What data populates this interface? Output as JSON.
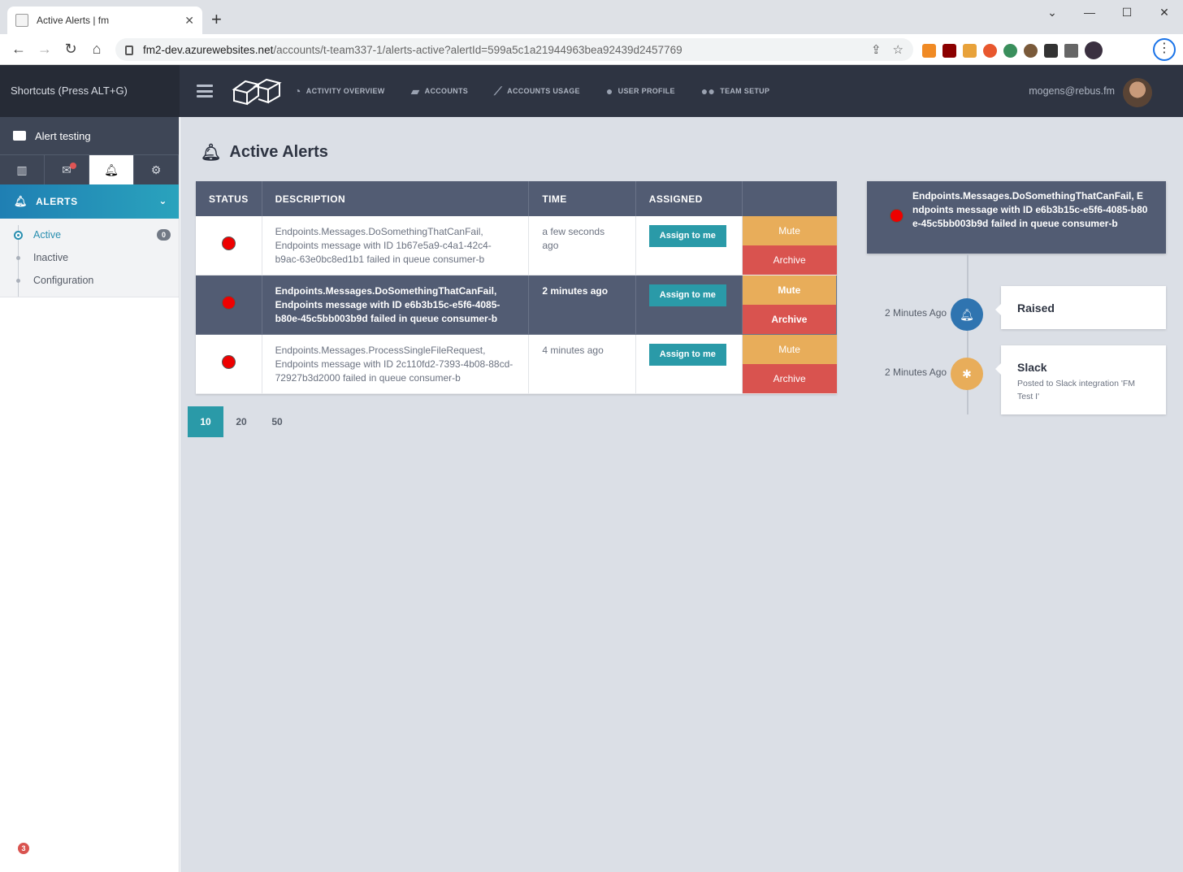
{
  "browser": {
    "tab_title": "Active Alerts | fm",
    "new_tab": "+",
    "url_host": "fm2-dev.azurewebsites.net",
    "url_path": "/accounts/t-team337-1/alerts-active?alertId=599a5c1a21944963bea92439d2457769",
    "window_buttons": [
      "⌄",
      "—",
      "☐",
      "✕"
    ]
  },
  "header": {
    "shortcuts": "Shortcuts (Press ALT+G)",
    "nav": [
      {
        "label": "ACTIVITY OVERVIEW",
        "icon": "dashboard-icon"
      },
      {
        "label": "ACCOUNTS",
        "icon": "folder-icon"
      },
      {
        "label": "ACCOUNTS USAGE",
        "icon": "line-chart-icon"
      },
      {
        "label": "USER PROFILE",
        "icon": "user-icon"
      },
      {
        "label": "TEAM SETUP",
        "icon": "users-icon"
      }
    ],
    "user": "mogens@rebus.fm"
  },
  "sidebar": {
    "project": "Alert testing",
    "section": "ALERTS",
    "items": [
      {
        "label": "Active",
        "count": "0"
      },
      {
        "label": "Inactive"
      },
      {
        "label": "Configuration"
      }
    ],
    "notification_count": "3"
  },
  "main": {
    "title": "Active Alerts",
    "columns": [
      "STATUS",
      "DESCRIPTION",
      "TIME",
      "ASSIGNED",
      ""
    ],
    "rows": [
      {
        "description": "Endpoints.Messages.DoSomethingThatCanFail, Endpoints message with ID 1b67e5a9-c4a1-42c4-b9ac-63e0bc8ed1b1 failed in queue consumer-b",
        "time": "a few seconds ago",
        "assign": "Assign to me",
        "mute": "Mute",
        "archive": "Archive"
      },
      {
        "description": "Endpoints.Messages.DoSomethingThatCanFail, Endpoints message with ID e6b3b15c-e5f6-4085-b80e-45c5bb003b9d failed in queue consumer-b",
        "time": "2 minutes ago",
        "assign": "Assign to me",
        "mute": "Mute",
        "archive": "Archive"
      },
      {
        "description": "Endpoints.Messages.ProcessSingleFileRequest, Endpoints message with ID 2c110fd2-7393-4b08-88cd-72927b3d2000 failed in queue consumer-b",
        "time": "4 minutes ago",
        "assign": "Assign to me",
        "mute": "Mute",
        "archive": "Archive"
      }
    ],
    "page_sizes": [
      "10",
      "20",
      "50"
    ]
  },
  "detail": {
    "text": "Endpoints.Messages.DoSomethingThatCanFail, Endpoints message with ID e6b3b15c-e5f6-4085-b80e-45c5bb003b9d failed in queue consumer-b",
    "timeline": [
      {
        "when": "2 Minutes Ago",
        "title": "Raised",
        "sub": ""
      },
      {
        "when": "2 Minutes Ago",
        "title": "Slack",
        "sub": "Posted to Slack integration 'FM Test I'"
      }
    ]
  },
  "colors": {
    "header_bg": "#2e3442",
    "panel_bg": "#525c73",
    "accent_teal": "#2a9aa8",
    "mute": "#e8ad5a",
    "archive": "#d9534f",
    "status_red": "#ee0000"
  }
}
